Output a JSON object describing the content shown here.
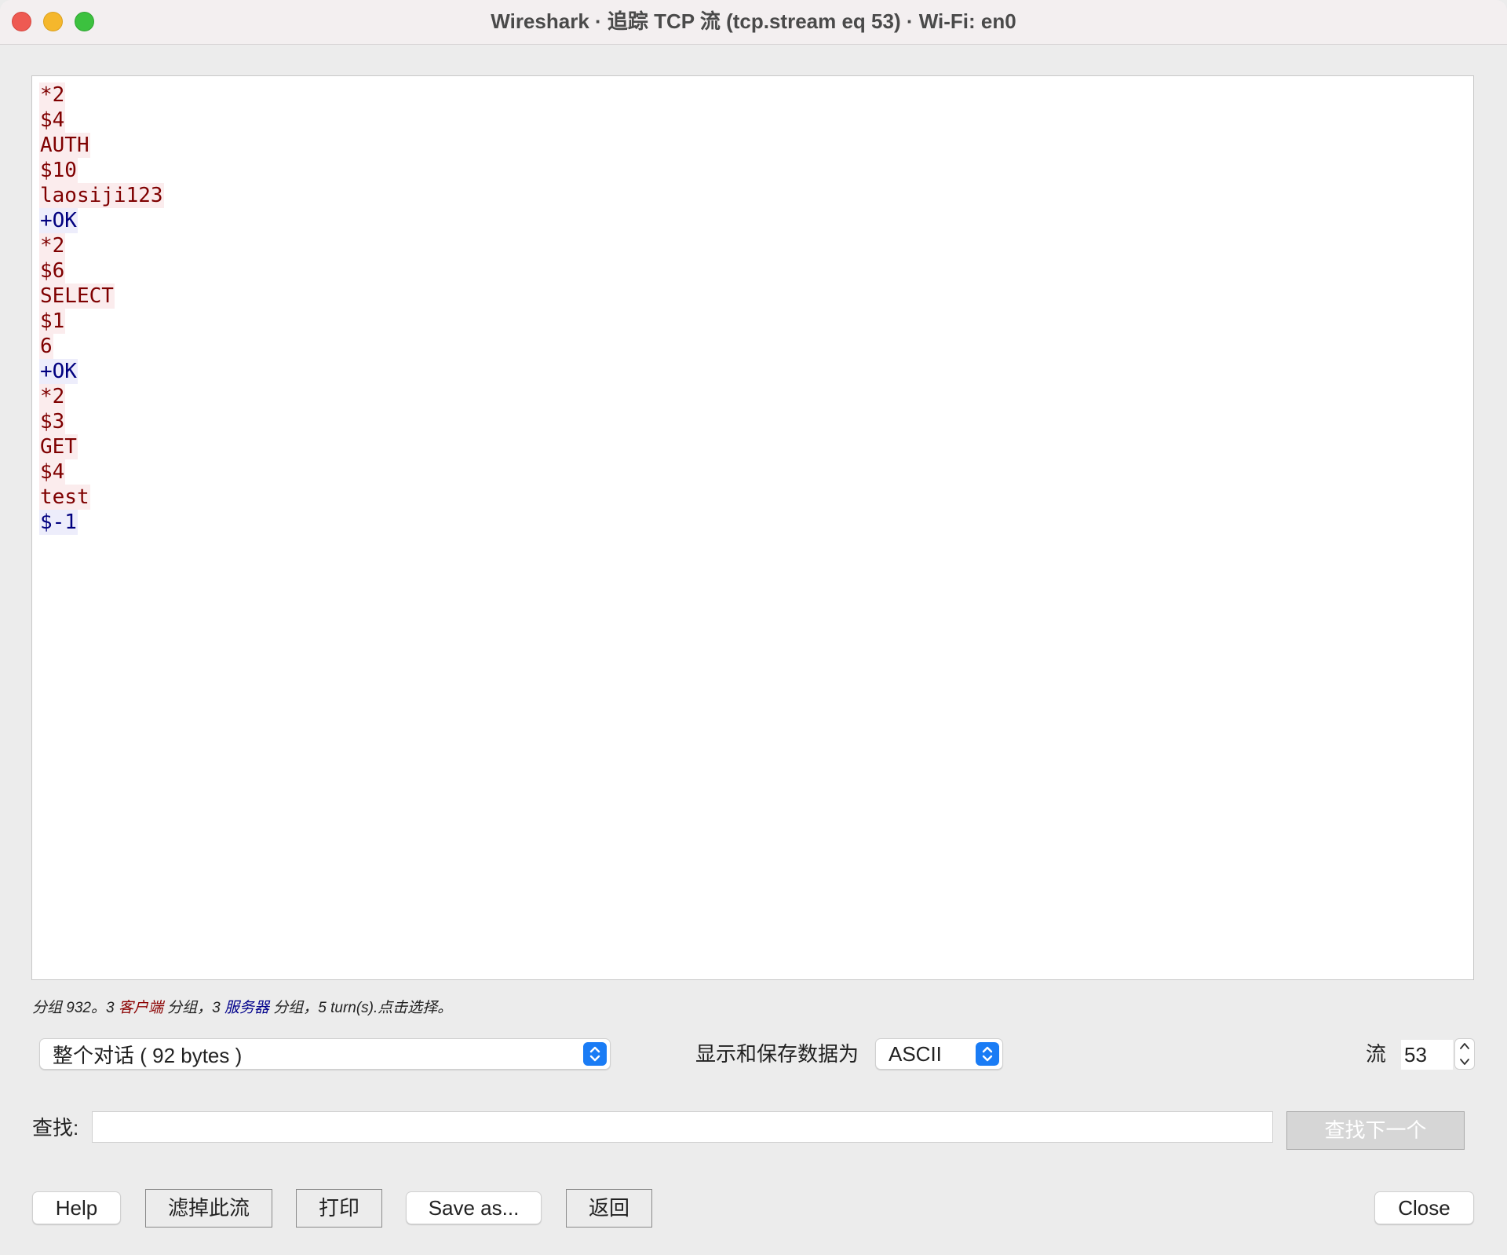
{
  "window": {
    "title": "Wireshark · 追踪 TCP 流 (tcp.stream eq 53) · Wi-Fi: en0"
  },
  "stream": {
    "lines": [
      {
        "text": "*2",
        "side": "client"
      },
      {
        "text": "$4",
        "side": "client"
      },
      {
        "text": "AUTH",
        "side": "client"
      },
      {
        "text": "$10",
        "side": "client"
      },
      {
        "text": "laosiji123",
        "side": "client"
      },
      {
        "text": "+OK",
        "side": "server"
      },
      {
        "text": "*2",
        "side": "client"
      },
      {
        "text": "$6",
        "side": "client"
      },
      {
        "text": "SELECT",
        "side": "client"
      },
      {
        "text": "$1",
        "side": "client"
      },
      {
        "text": "6",
        "side": "client"
      },
      {
        "text": "+OK",
        "side": "server"
      },
      {
        "text": "*2",
        "side": "client"
      },
      {
        "text": "$3",
        "side": "client"
      },
      {
        "text": "GET",
        "side": "client"
      },
      {
        "text": "$4",
        "side": "client"
      },
      {
        "text": "test",
        "side": "client"
      },
      {
        "text": "$-1",
        "side": "server"
      }
    ],
    "colors": {
      "client_text": "#7f0000",
      "client_bg": "#fbeced",
      "server_text": "#00007f",
      "server_bg": "#ededfb"
    }
  },
  "stats": {
    "prefix": "分组 932。3 ",
    "client_word": "客户端",
    "middle": " 分组，3 ",
    "server_word": "服务器",
    "suffix": " 分组，5 turn(s).点击选择。"
  },
  "controls": {
    "conversation_value": "整个对话 ( 92 bytes )",
    "format_label": "显示和保存数据为",
    "format_value": "ASCII",
    "stream_label": "流",
    "stream_value": "53",
    "stepper_icon": "up-down-chevron-icon",
    "accent_color": "#1a7cf5"
  },
  "find": {
    "label": "查找:",
    "value": "",
    "next_label": "查找下一个"
  },
  "buttons": {
    "help": "Help",
    "filter_out": "滤掉此流",
    "print": "打印",
    "save_as": "Save as...",
    "back": "返回",
    "close": "Close"
  }
}
